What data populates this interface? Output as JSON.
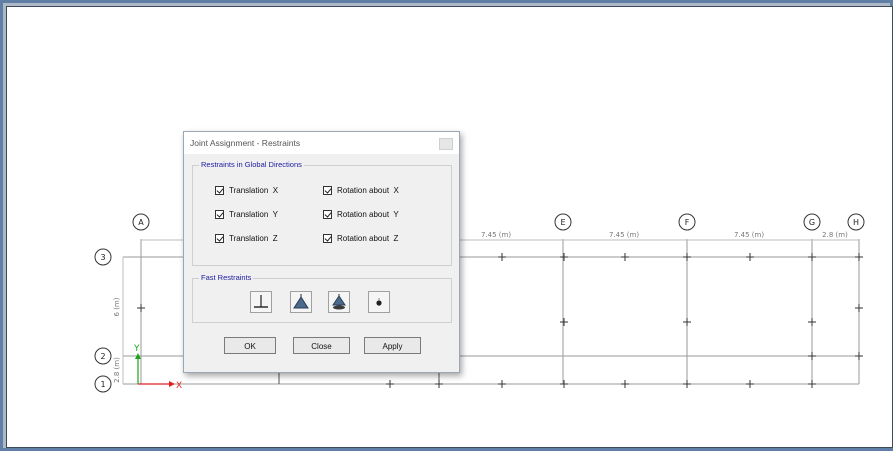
{
  "grid": {
    "columns": [
      "A",
      "E",
      "F",
      "G",
      "H"
    ],
    "rows": [
      "3",
      "2",
      "1"
    ],
    "x_spacings": [
      "7.45 (m)",
      "7.45 (m)",
      "7.45 (m)",
      "2.8 (m)"
    ],
    "y_spacings": [
      "6 (m)",
      "2.8 (m)"
    ],
    "axis_x": "X",
    "axis_y": "Y"
  },
  "dialog": {
    "title": "Joint Assignment - Restraints",
    "global_group_title": "Restraints in Global Directions",
    "restraints": [
      {
        "label": "Translation  X",
        "checked": true
      },
      {
        "label": "Rotation about  X",
        "checked": true
      },
      {
        "label": "Translation  Y",
        "checked": true
      },
      {
        "label": "Rotation about  Y",
        "checked": true
      },
      {
        "label": "Translation  Z",
        "checked": true
      },
      {
        "label": "Rotation about  Z",
        "checked": true
      }
    ],
    "fast_group_title": "Fast Restraints",
    "fast_buttons": [
      "fixed-support-icon",
      "pinned-support-icon",
      "roller-support-icon",
      "free-joint-icon"
    ],
    "buttons": {
      "ok": "OK",
      "close": "Close",
      "apply": "Apply"
    }
  },
  "colors": {
    "axis_x": "#e02020",
    "axis_y": "#1aa51a",
    "group_title": "#1a1aa0"
  }
}
